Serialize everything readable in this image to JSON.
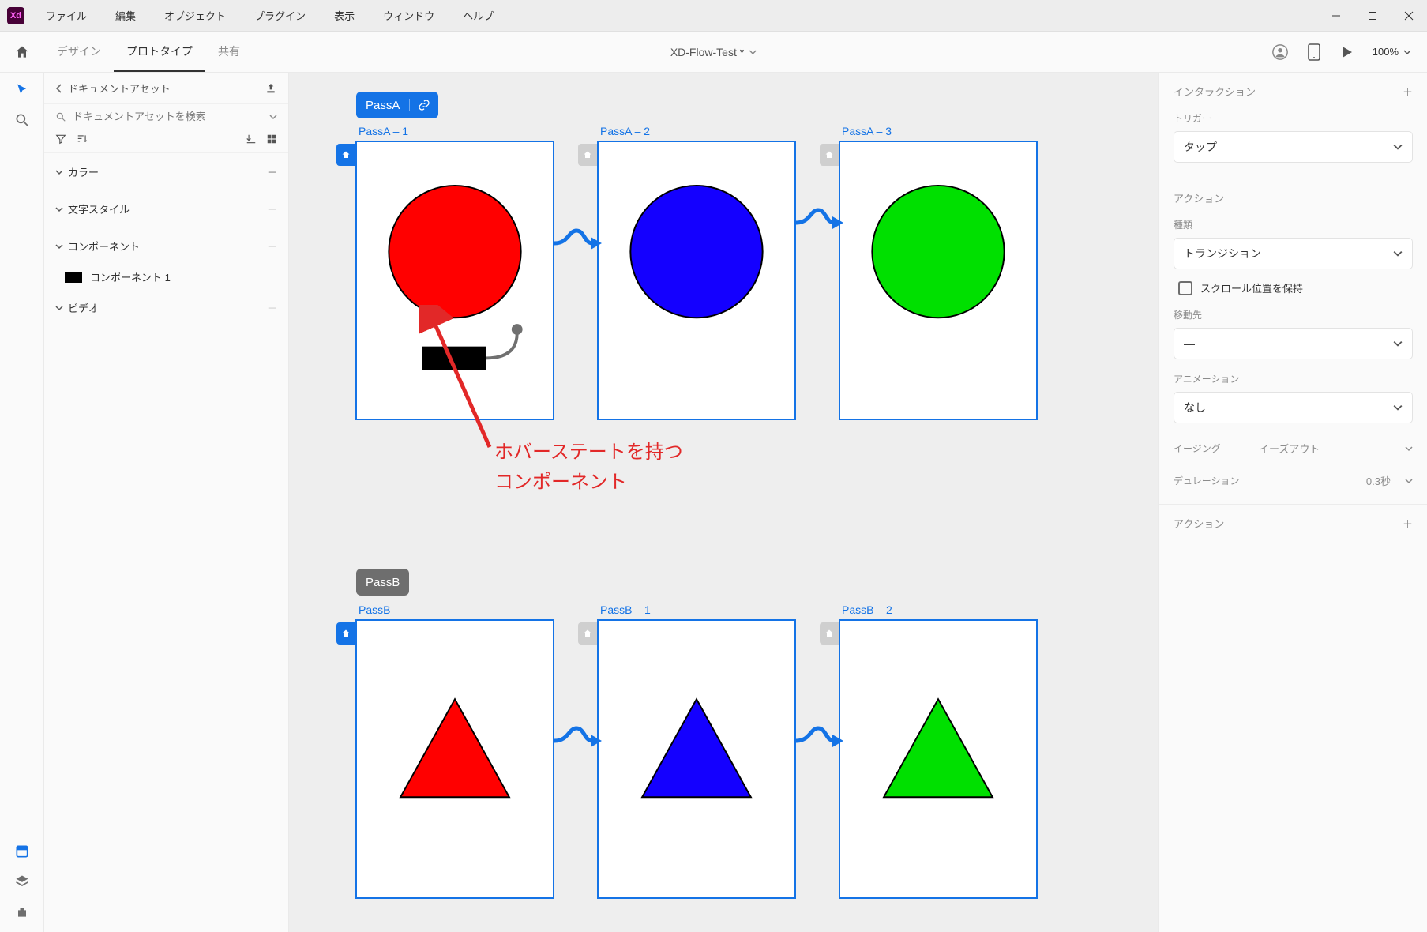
{
  "menubar": {
    "items": [
      "ファイル",
      "編集",
      "オブジェクト",
      "プラグイン",
      "表示",
      "ウィンドウ",
      "ヘルプ"
    ]
  },
  "appbar": {
    "tabs": {
      "design": "デザイン",
      "prototype": "プロトタイプ",
      "share": "共有"
    },
    "doc_title": "XD-Flow-Test *",
    "zoom": "100%"
  },
  "left_panel": {
    "back_label": "ドキュメントアセット",
    "search_placeholder": "ドキュメントアセットを検索",
    "sections": {
      "colors": "カラー",
      "char_styles": "文字スタイル",
      "components": "コンポーネント",
      "video": "ビデオ"
    },
    "component_item": "コンポーネント 1"
  },
  "canvas": {
    "flowA": {
      "name": "PassA",
      "artboards": [
        "PassA – 1",
        "PassA – 2",
        "PassA – 3"
      ]
    },
    "flowB": {
      "name": "PassB",
      "artboards": [
        "PassB",
        "PassB – 1",
        "PassB – 2"
      ]
    },
    "annotation": {
      "line1": "ホバーステートを持つ",
      "line2": "コンポーネント"
    }
  },
  "right_panel": {
    "interaction_title": "インタラクション",
    "trigger_label": "トリガー",
    "trigger_value": "タップ",
    "action_title": "アクション",
    "type_label": "種類",
    "type_value": "トランジション",
    "preserve_scroll": "スクロール位置を保持",
    "destination_label": "移動先",
    "destination_value": "—",
    "animation_label": "アニメーション",
    "animation_value": "なし",
    "easing_label": "イージング",
    "easing_value": "イーズアウト",
    "duration_label": "デュレーション",
    "duration_value": "0.3秒",
    "action_add_title": "アクション"
  }
}
